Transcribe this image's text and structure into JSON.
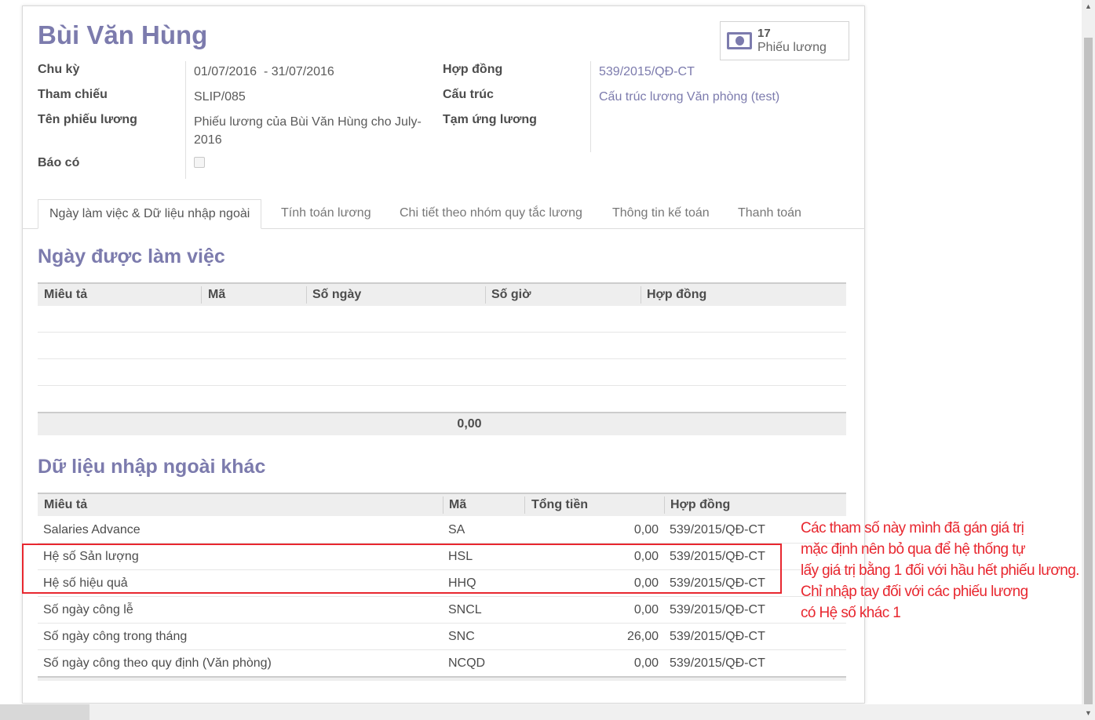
{
  "record": {
    "title": "Bùi Văn Hùng",
    "stat": {
      "count": "17",
      "label": "Phiếu lương",
      "icon": "money-icon"
    }
  },
  "fields_left": [
    {
      "label": "Chu kỳ",
      "value": "01/07/2016  - 31/07/2016"
    },
    {
      "label": "Tham chiếu",
      "value": "SLIP/085"
    },
    {
      "label": "Tên phiếu lương",
      "value": "Phiếu lương của Bùi Văn Hùng cho July-2016"
    },
    {
      "label": "Báo có",
      "value": ""
    }
  ],
  "fields_right": [
    {
      "label": "Hợp đồng",
      "value": "539/2015/QĐ-CT"
    },
    {
      "label": "Cấu trúc",
      "value": "Cấu trúc lương Văn phòng (test)"
    },
    {
      "label": "Tạm ứng lương",
      "value": ""
    }
  ],
  "tabs": [
    "Ngày làm việc & Dữ liệu nhập ngoài",
    "Tính toán lương",
    "Chi tiết theo nhóm quy tắc lương",
    "Thông tin kế toán",
    "Thanh toán"
  ],
  "worked_days": {
    "title": "Ngày được làm việc",
    "columns": [
      "Miêu tả",
      "Mã",
      "Số ngày",
      "Số giờ",
      "Hợp đồng"
    ],
    "total": "0,00"
  },
  "inputs": {
    "title": "Dữ liệu nhập ngoài khác",
    "columns": [
      "Miêu tả",
      "Mã",
      "Tổng tiền",
      "Hợp đồng"
    ],
    "rows": [
      {
        "desc": "Salaries Advance",
        "code": "SA",
        "amount": "0,00",
        "contract": "539/2015/QĐ-CT"
      },
      {
        "desc": "Hệ số Sản lượng",
        "code": "HSL",
        "amount": "0,00",
        "contract": "539/2015/QĐ-CT"
      },
      {
        "desc": "Hệ số hiệu quả",
        "code": "HHQ",
        "amount": "0,00",
        "contract": "539/2015/QĐ-CT"
      },
      {
        "desc": "Số ngày công lễ",
        "code": "SNCL",
        "amount": "0,00",
        "contract": "539/2015/QĐ-CT"
      },
      {
        "desc": "Số ngày công trong tháng",
        "code": "SNC",
        "amount": "26,00",
        "contract": "539/2015/QĐ-CT"
      },
      {
        "desc": "Số ngày công theo quy định (Văn phòng)",
        "code": "NCQD",
        "amount": "0,00",
        "contract": "539/2015/QĐ-CT"
      }
    ]
  },
  "annotation": {
    "color": "#e8272f",
    "lines": [
      "Các tham số này mình đã gán giá trị",
      "mặc định nên bỏ qua để hệ thống tự",
      "lấy giá trị bằng 1 đối với hầu hết phiếu lương.",
      "Chỉ nhập tay đối với các phiếu lương",
      "có Hệ số khác 1"
    ]
  },
  "colors": {
    "accent": "#7c7bad",
    "annotation": "#e8272f"
  }
}
